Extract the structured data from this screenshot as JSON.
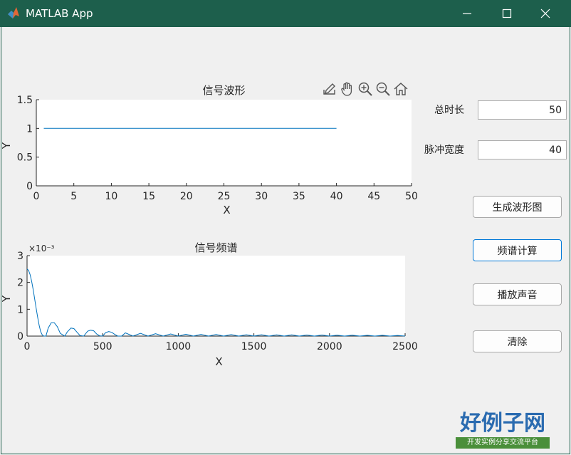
{
  "window": {
    "title": "MATLAB App",
    "icon": "matlab-icon",
    "controls": [
      "minimize-icon",
      "maximize-icon",
      "close-icon"
    ],
    "titlebar_color": "#1d5f4c"
  },
  "toolbar": [
    "export-icon",
    "pan-icon",
    "zoom-in-icon",
    "zoom-out-icon",
    "home-icon"
  ],
  "form": {
    "total_duration_label": "总时长",
    "total_duration_value": "50",
    "pulse_width_label": "脉冲宽度",
    "pulse_width_value": "40"
  },
  "buttons": {
    "generate": "生成波形图",
    "spectrum": "频谱计算",
    "play": "播放声音",
    "clear": "清除"
  },
  "logo": {
    "text": "好例子网",
    "subtext": "开发实例分享交流平台"
  },
  "chart_data": [
    {
      "type": "line",
      "title": "信号波形",
      "xlabel": "X",
      "ylabel": "Y",
      "xlim": [
        0,
        50
      ],
      "ylim": [
        0,
        1.5
      ],
      "xticks": [
        0,
        5,
        10,
        15,
        20,
        25,
        30,
        35,
        40,
        45,
        50
      ],
      "yticks": [
        0,
        0.5,
        1,
        1.5
      ],
      "ytick_labels": [
        "0",
        "0.5",
        "1",
        "1.5"
      ],
      "grid": false,
      "color": "#0072bd",
      "x": [
        1,
        40
      ],
      "y": [
        1,
        1
      ]
    },
    {
      "type": "line",
      "title": "信号频谱",
      "xlabel": "X",
      "ylabel": "Y",
      "y_exponent_label": "×10⁻³",
      "xlim": [
        0,
        2500
      ],
      "ylim": [
        0,
        3
      ],
      "xticks": [
        0,
        500,
        1000,
        1500,
        2000,
        2500
      ],
      "yticks": [
        0,
        1,
        2,
        3
      ],
      "grid": false,
      "color": "#0072bd",
      "x": [
        0,
        10,
        20,
        30,
        40,
        50,
        60,
        70,
        80,
        90,
        100,
        110,
        125,
        140,
        160,
        180,
        200,
        220,
        250,
        265,
        290,
        310,
        330,
        350,
        375,
        400,
        420,
        440,
        460,
        480,
        500,
        520,
        540,
        560,
        580,
        600,
        625,
        650,
        700,
        750,
        800,
        850,
        900,
        950,
        1000,
        1050,
        1100,
        1150,
        1200,
        1250,
        1300,
        1350,
        1400,
        1450,
        1500,
        1550,
        1600,
        1650,
        1700,
        1750,
        1800,
        1850,
        1900,
        1950,
        2000,
        2050,
        2100,
        2150,
        2200,
        2250,
        2300,
        2350,
        2400,
        2450,
        2500
      ],
      "y": [
        2.5,
        2.45,
        2.3,
        2.05,
        1.75,
        1.4,
        1.05,
        0.7,
        0.4,
        0.17,
        0.05,
        0.0,
        0.0,
        0.3,
        0.5,
        0.5,
        0.35,
        0.1,
        0.0,
        0.15,
        0.3,
        0.28,
        0.15,
        0.02,
        0.0,
        0.18,
        0.22,
        0.2,
        0.08,
        0.01,
        0.0,
        0.13,
        0.17,
        0.14,
        0.06,
        0.0,
        0.0,
        0.12,
        0.0,
        0.1,
        0.0,
        0.09,
        0.0,
        0.08,
        0.0,
        0.07,
        0.0,
        0.065,
        0.0,
        0.06,
        0.0,
        0.055,
        0.0,
        0.05,
        0.0,
        0.05,
        0.0,
        0.045,
        0.0,
        0.045,
        0.0,
        0.04,
        0.0,
        0.04,
        0.0,
        0.035,
        0.0,
        0.035,
        0.0,
        0.03,
        0.0,
        0.03,
        0.0,
        0.025,
        0.0
      ]
    }
  ]
}
